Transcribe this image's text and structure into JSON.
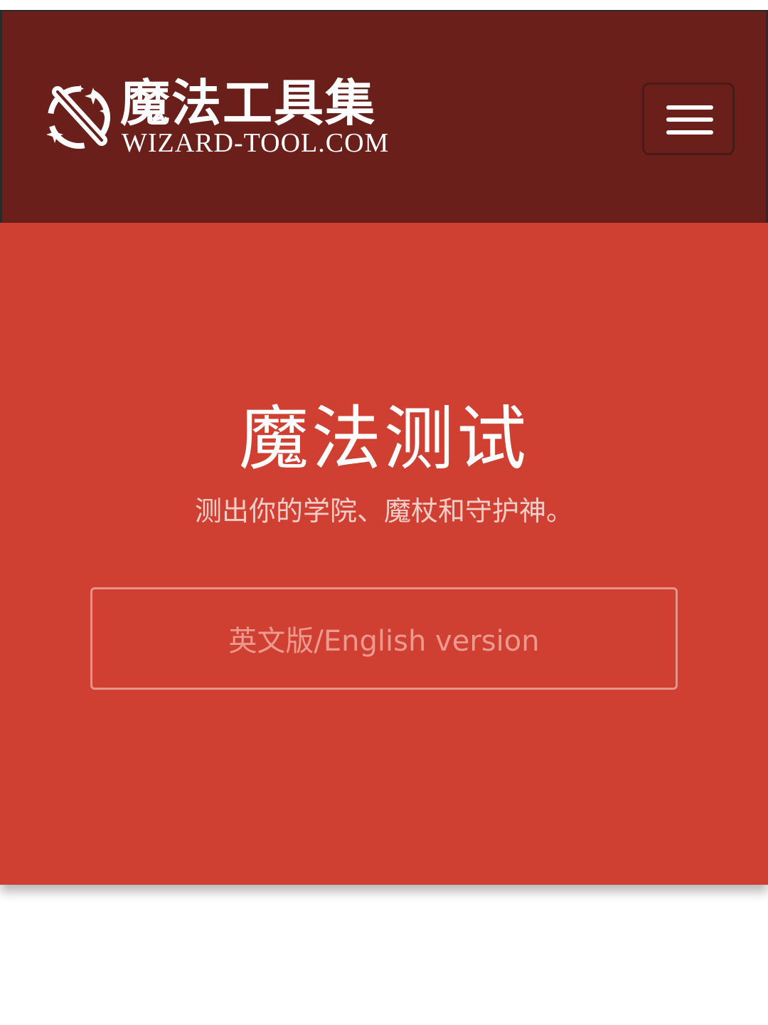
{
  "colors": {
    "navbar_bg": "#6b1f1a",
    "hero_bg": "#d04032",
    "white": "#ffffff",
    "subtitle_text": "#f3cdc8",
    "button_border": "#e7948b",
    "button_text": "#ee9990"
  },
  "header": {
    "logo_icon": "magic-wand-icon",
    "brand_title": "魔法工具集",
    "brand_subtitle": "WIZARD-TOOL.COM",
    "menu_icon": "hamburger-menu-icon"
  },
  "hero": {
    "title": "魔法测试",
    "subtitle": "测出你的学院、魔杖和守护神。",
    "english_button_label": "英文版/English version"
  }
}
